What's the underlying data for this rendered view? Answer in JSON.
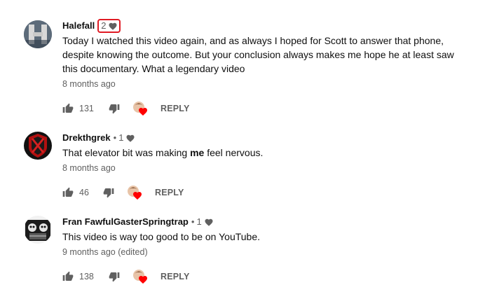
{
  "comments": [
    {
      "author": "Halefall",
      "heart_count": "2",
      "text": "Today I watched this video again, and as always I hoped for Scott to answer that phone, despite knowing the outcome. But your conclusion always makes me hope he at least saw this documentary. What a legendary video",
      "time": "8 months ago",
      "likes": "131",
      "reply_label": "REPLY"
    },
    {
      "author": "Drekthgrek",
      "heart_count": "1",
      "text_before": "That elevator bit was making ",
      "text_bold": "me",
      "text_after": " feel nervous.",
      "time": "8 months ago",
      "likes": "46",
      "reply_label": "REPLY"
    },
    {
      "author": "Fran FawfulGasterSpringtrap",
      "heart_count": "1",
      "text": "This video is way too good to be on YouTube.",
      "time": "9 months ago (edited)",
      "likes": "138",
      "reply_label": "REPLY"
    }
  ],
  "colors": {
    "highlight": "#e01b24",
    "heart": "#ff0000",
    "meta": "#606060"
  },
  "icons": [
    "thumb-up-icon",
    "thumb-down-icon",
    "creator-heart-icon",
    "heart-icon"
  ]
}
